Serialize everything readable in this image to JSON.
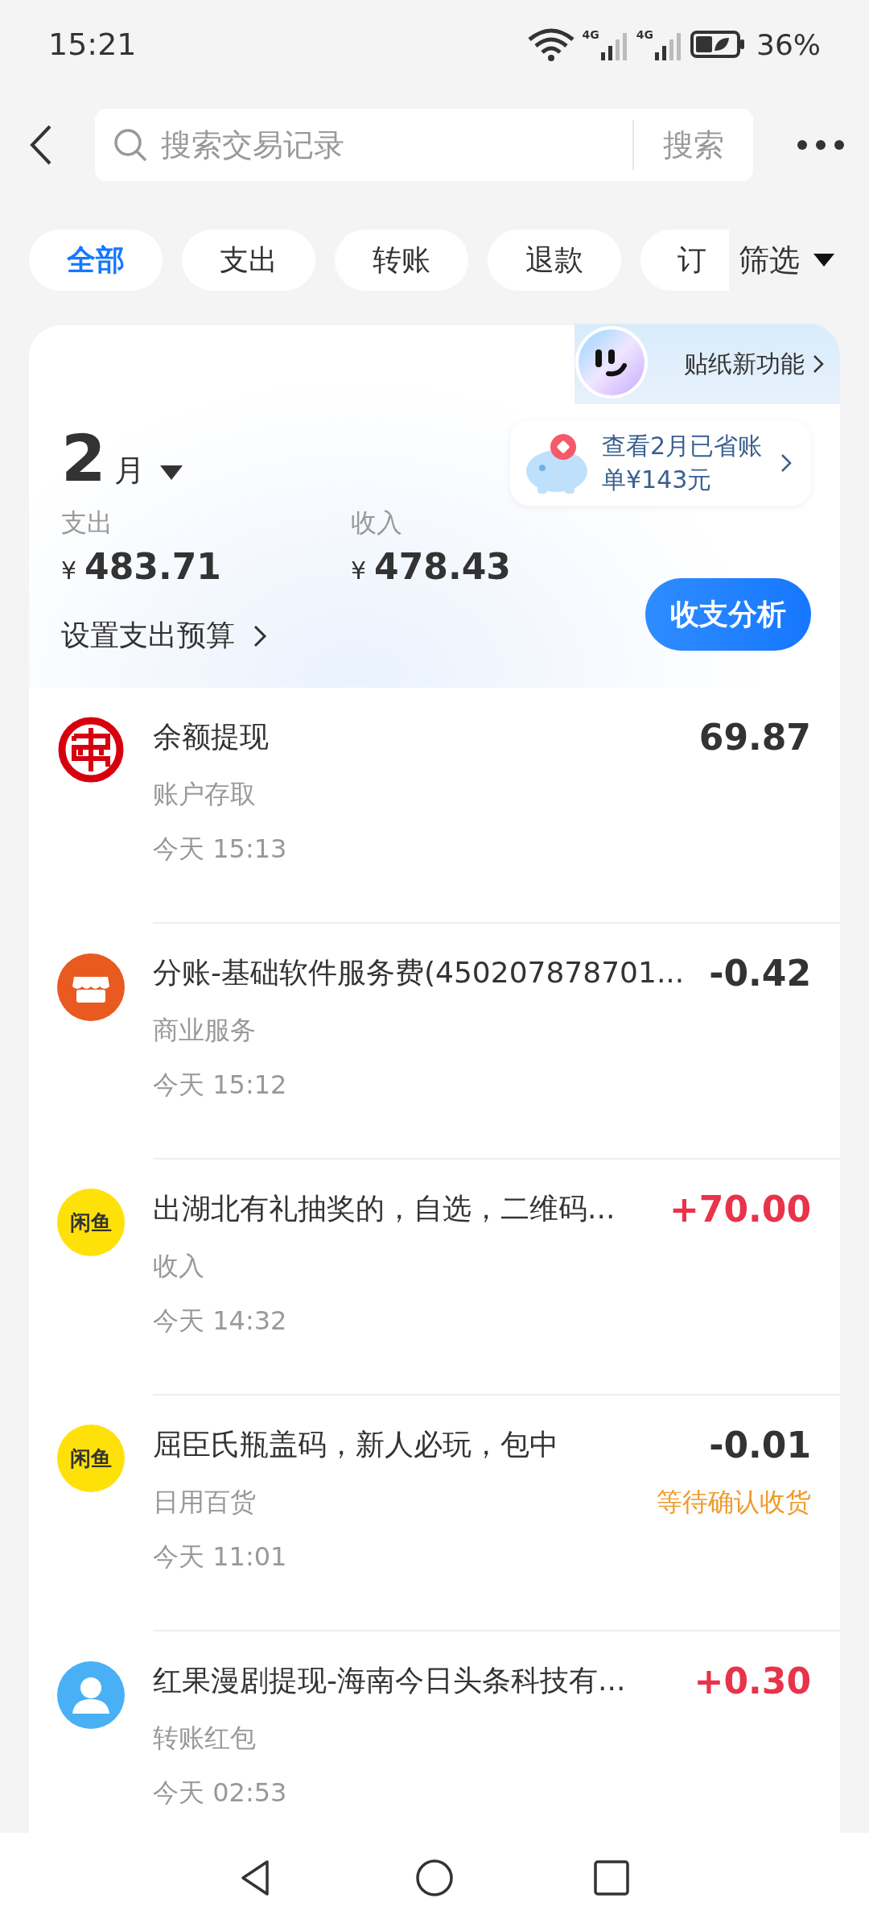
{
  "status_bar": {
    "time": "15:21",
    "network_1": "4G",
    "network_2": "4G",
    "battery": "36%"
  },
  "search": {
    "placeholder": "搜索交易记录",
    "button": "搜索"
  },
  "filters": [
    {
      "label": "全部",
      "selected": true
    },
    {
      "label": "支出",
      "selected": false
    },
    {
      "label": "转账",
      "selected": false
    },
    {
      "label": "退款",
      "selected": false
    },
    {
      "label": "订",
      "selected": false
    }
  ],
  "filter_menu": "筛选",
  "summary": {
    "month": "2",
    "month_unit": "月",
    "expense_label": "支出",
    "expense": "483.71",
    "income_label": "收入",
    "income": "478.43",
    "currency": "¥",
    "budget_link": "设置支出预算",
    "sticker_promo": "贴纸新功能",
    "savings_tip": "查看2月已省账单¥143元",
    "analysis_button": "收支分析"
  },
  "transactions": [
    {
      "icon": {
        "kind": "bank"
      },
      "title": "余额提现",
      "category": "账户存取",
      "time": "今天 15:13",
      "amount": "69.87",
      "kind": "neutral"
    },
    {
      "icon": {
        "kind": "store"
      },
      "title": "分账-基础软件服务费(450207878701...",
      "category": "商业服务",
      "time": "今天 15:12",
      "amount": "-0.42",
      "kind": "neutral"
    },
    {
      "icon": {
        "kind": "logo",
        "text": "闲鱼"
      },
      "title": "出湖北有礼抽奖的，自选，二维码...",
      "category": "收入",
      "time": "今天 14:32",
      "amount": "+70.00",
      "kind": "income"
    },
    {
      "icon": {
        "kind": "logo",
        "text": "闲鱼"
      },
      "title": "屈臣氏瓶盖码，新人必玩，包中",
      "category": "日用百货",
      "time": "今天 11:01",
      "amount": "-0.01",
      "kind": "neutral",
      "status": "等待确认收货"
    },
    {
      "icon": {
        "kind": "person"
      },
      "title": "红果漫剧提现-海南今日头条科技有...",
      "category": "转账红包",
      "time": "今天 02:53",
      "amount": "+0.30",
      "kind": "income"
    }
  ]
}
